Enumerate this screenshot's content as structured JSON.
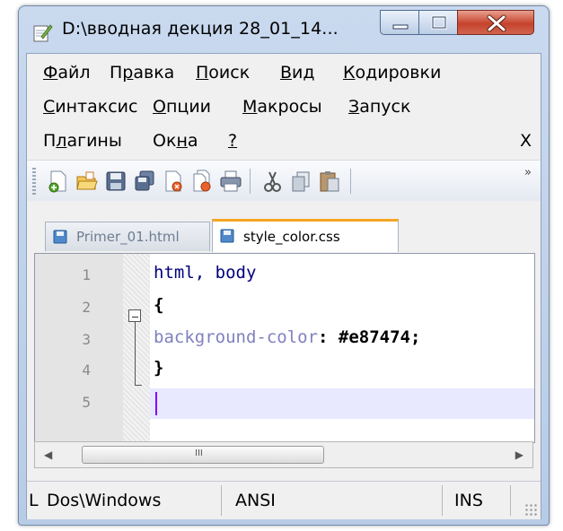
{
  "window": {
    "title": "D:\\вводная декция 28_01_14..."
  },
  "menu": {
    "row1": [
      {
        "pre": "",
        "u": "Ф",
        "post": "айл"
      },
      {
        "pre": "П",
        "u": "р",
        "post": "авка"
      },
      {
        "pre": "",
        "u": "П",
        "post": "оиск"
      },
      {
        "pre": "",
        "u": "В",
        "post": "ид"
      },
      {
        "pre": "",
        "u": "К",
        "post": "одировки"
      }
    ],
    "row2": [
      {
        "pre": "",
        "u": "С",
        "post": "интаксис"
      },
      {
        "pre": "",
        "u": "О",
        "post": "пции"
      },
      {
        "pre": "",
        "u": "М",
        "post": "акросы"
      },
      {
        "pre": "",
        "u": "З",
        "post": "апуск"
      }
    ],
    "row3": [
      {
        "pre": "П",
        "u": "л",
        "post": "агины"
      },
      {
        "pre": "Ок",
        "u": "н",
        "post": "а"
      },
      {
        "pre": "",
        "u": "?",
        "post": ""
      }
    ],
    "close_label": "X"
  },
  "toolbar": {
    "more_label": "»",
    "icons": [
      "new-file-icon",
      "open-file-icon",
      "save-icon",
      "save-all-icon",
      "close-file-icon",
      "close-all-icon",
      "print-icon",
      "cut-icon",
      "copy-icon",
      "paste-icon"
    ]
  },
  "tabs": [
    {
      "label": "Primer_01.html",
      "active": false
    },
    {
      "label": "style_color.css",
      "active": true
    }
  ],
  "editor": {
    "lines": [
      {
        "num": "1",
        "text": "html, body"
      },
      {
        "num": "2",
        "text": "{"
      },
      {
        "num": "3",
        "prop": "background-color",
        "colon": ": ",
        "value": "#e87474",
        "semi": ";"
      },
      {
        "num": "4",
        "text": "}"
      },
      {
        "num": "5",
        "text": ""
      }
    ]
  },
  "scrollbar": {
    "left_arrow": "◀",
    "right_arrow": "▶",
    "grip": "III"
  },
  "status": {
    "cells": [
      {
        "text": "L"
      },
      {
        "text": "Dos\\Windows"
      },
      {
        "text": "ANSI"
      },
      {
        "text": "INS"
      }
    ]
  },
  "colors": {
    "selector": "#000080",
    "property": "#8080c0",
    "value": "#000000",
    "caret": "#8000ff",
    "active_tab_accent": "#f5a623"
  }
}
